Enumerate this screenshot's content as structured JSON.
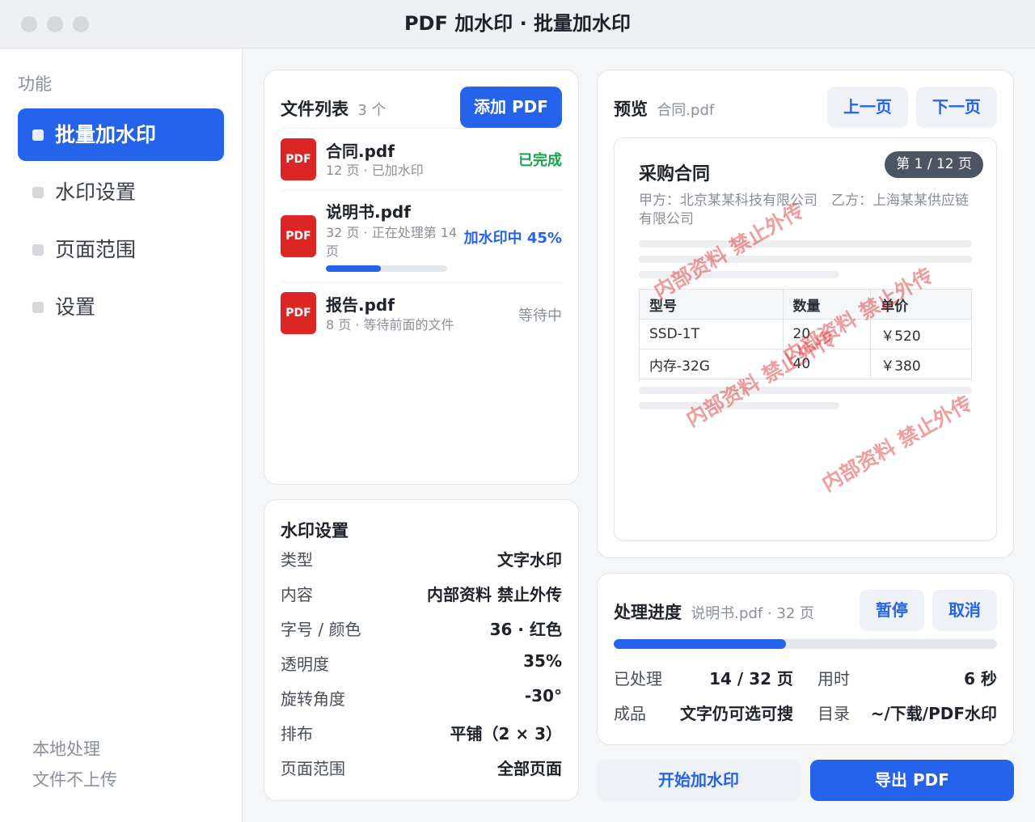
{
  "window": {
    "title": "PDF 加水印 · 批量加水印"
  },
  "sidebar": {
    "heading": "功能",
    "items": [
      {
        "label": "批量加水印",
        "active": true
      },
      {
        "label": "水印设置",
        "active": false
      },
      {
        "label": "页面范围",
        "active": false
      },
      {
        "label": "设置",
        "active": false
      }
    ],
    "footer": [
      "本地处理",
      "文件不上传"
    ]
  },
  "file_list": {
    "title": "文件列表",
    "count": "3 个",
    "add_button": "添加 PDF",
    "files": [
      {
        "icon": "PDF",
        "name": "合同.pdf",
        "meta": "12 页 · 已加水印",
        "status": "已完成",
        "status_color": "#16a34a"
      },
      {
        "icon": "PDF",
        "name": "说明书.pdf",
        "meta": "32 页 · 正在处理第 14 页",
        "status": "加水印中 45%",
        "status_color": "#2563eb",
        "progress": 0.45
      },
      {
        "icon": "PDF",
        "name": "报告.pdf",
        "meta": "8 页 · 等待前面的文件",
        "status": "等待中",
        "status_color": "#8a8f98"
      }
    ]
  },
  "watermark_settings": {
    "title": "水印设置",
    "rows": [
      {
        "key": "类型",
        "value": "文字水印"
      },
      {
        "key": "内容",
        "value": "内部资料 禁止外传"
      },
      {
        "key": "字号 / 颜色",
        "value": "36 · 红色"
      },
      {
        "key": "透明度",
        "value": "35%"
      },
      {
        "key": "旋转角度",
        "value": "-30°"
      },
      {
        "key": "排布",
        "value": "平铺（2 × 3）"
      },
      {
        "key": "页面范围",
        "value": "全部页面"
      }
    ]
  },
  "preview": {
    "title": "预览",
    "file": "合同.pdf",
    "prev_button": "上一页",
    "next_button": "下一页",
    "page_badge": "第 1 / 12 页",
    "doc_title": "采购合同",
    "parties": "甲方：北京某某科技有限公司　乙方：上海某某供应链有限公司",
    "table": {
      "headers": [
        "型号",
        "数量",
        "单价"
      ],
      "rows": [
        [
          "SSD-1T",
          "20",
          "￥520"
        ],
        [
          "内存-32G",
          "40",
          "￥380"
        ]
      ]
    },
    "watermark_text": "内部资料 禁止外传"
  },
  "progress": {
    "title": "处理进度",
    "sub": "说明书.pdf · 32 页",
    "pause_button": "暂停",
    "cancel_button": "取消",
    "fraction": 0.45,
    "stats": [
      {
        "label": "已处理",
        "value": "14 / 32 页"
      },
      {
        "label": "用时",
        "value": "6 秒"
      },
      {
        "label": "成品",
        "value": "文字仍可选可搜"
      },
      {
        "label": "目录",
        "value": "~/下载/PDF水印"
      }
    ]
  },
  "actions": {
    "start_button": "开始加水印",
    "export_button": "导出 PDF"
  },
  "colors": {
    "accent": "#2563eb",
    "done": "#16a34a",
    "pdf_icon": "#dc2626",
    "watermark": "#dc2626"
  }
}
